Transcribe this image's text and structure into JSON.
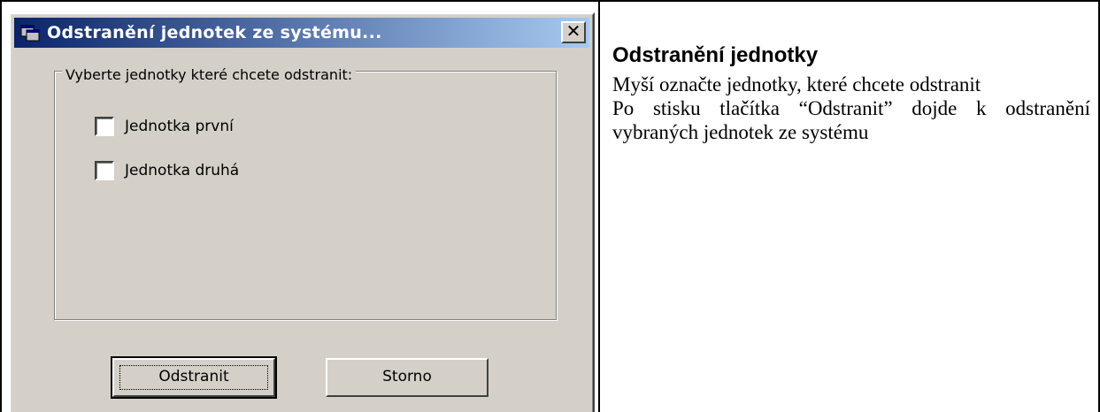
{
  "dialog": {
    "title": "Odstranění jednotek ze systému...",
    "close_label": "✕",
    "group_label": "Vyberte jednotky které chcete odstranit:",
    "checkboxes": [
      {
        "label": "Jednotka první",
        "checked": false
      },
      {
        "label": "Jednotka druhá",
        "checked": false
      }
    ],
    "buttons": {
      "remove": "Odstranit",
      "cancel": "Storno"
    }
  },
  "description": {
    "heading": "Odstranění jednotky",
    "paragraphs": [
      "Myší označte jednotky, které chcete odstranit",
      "Po stisku tlačítka “Odstranit” dojde k odstranění vybraných jednotek ze systému"
    ]
  }
}
